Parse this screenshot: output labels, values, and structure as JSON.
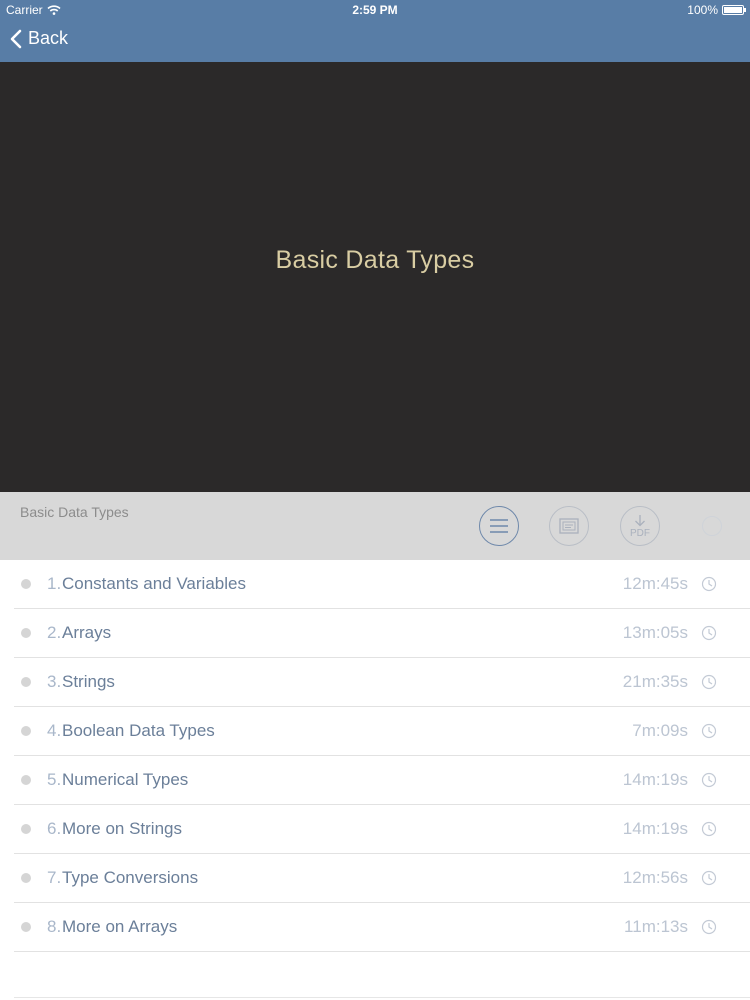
{
  "status_bar": {
    "carrier": "Carrier",
    "time": "2:59 PM",
    "battery_label": "100%",
    "battery_level": 1.0
  },
  "nav": {
    "back_label": "Back"
  },
  "video": {
    "title": "Basic Data Types"
  },
  "section": {
    "title": "Basic Data Types",
    "buttons": [
      {
        "icon": "list-icon"
      },
      {
        "icon": "slides-icon"
      },
      {
        "icon": "pdf-download-icon",
        "label": "PDF"
      },
      {
        "icon": "circle-icon"
      }
    ]
  },
  "lessons": [
    {
      "num": "1.",
      "title": "Constants and Variables",
      "duration": "12m:45s"
    },
    {
      "num": "2.",
      "title": "Arrays",
      "duration": "13m:05s"
    },
    {
      "num": "3.",
      "title": "Strings",
      "duration": "21m:35s"
    },
    {
      "num": "4.",
      "title": "Boolean Data Types",
      "duration": "7m:09s"
    },
    {
      "num": "5.",
      "title": "Numerical Types",
      "duration": "14m:19s"
    },
    {
      "num": "6.",
      "title": "More on Strings",
      "duration": "14m:19s"
    },
    {
      "num": "7.",
      "title": "Type Conversions",
      "duration": "12m:56s"
    },
    {
      "num": "8.",
      "title": "More on Arrays",
      "duration": "11m:13s"
    }
  ],
  "colors": {
    "nav_bar": "#587da6",
    "video_bg": "#2b2929",
    "video_title": "#d9cda3",
    "section_bg": "#d8d8d8",
    "lesson_title": "#6b7f99"
  }
}
